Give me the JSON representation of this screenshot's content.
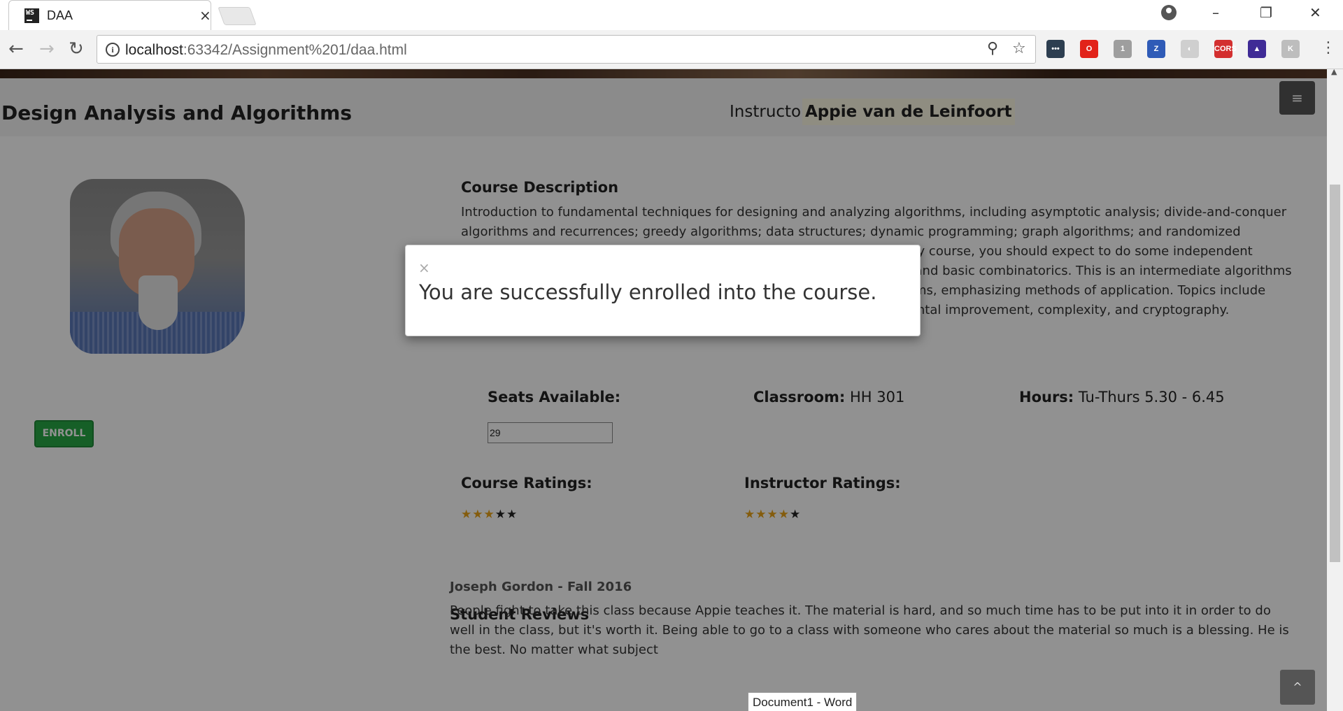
{
  "browser": {
    "tab_title": "DAA",
    "tab_close": "×",
    "favicon_text": "WS",
    "url_host": "localhost",
    "url_rest": ":63342/Assignment%201/daa.html",
    "window_controls": {
      "minimize": "–",
      "restore": "❐",
      "close": "✕"
    },
    "extensions": [
      {
        "name": "ext-dots-icon",
        "label": "•••",
        "color": "#2d3e50"
      },
      {
        "name": "ext-opera-icon",
        "label": "O",
        "color": "#e2231a"
      },
      {
        "name": "ext-shield-icon",
        "label": "1",
        "color": "#9e9e9e"
      },
      {
        "name": "ext-z-icon",
        "label": "Z",
        "color": "#2f5bb7"
      },
      {
        "name": "ext-moon-icon",
        "label": "◐",
        "color": "#cfcfcf"
      },
      {
        "name": "ext-cors-icon",
        "label": "CORS",
        "color": "#d32f2f"
      },
      {
        "name": "ext-graph-icon",
        "label": "▲",
        "color": "#3f2b96"
      },
      {
        "name": "ext-puzzle-icon",
        "label": "K",
        "color": "#bdbdbd"
      }
    ]
  },
  "page": {
    "title": "Design Analysis and Algorithms",
    "instructor_label": "Instructor:",
    "instructor_name": "Appie van de Leinfoort",
    "menu_icon": "≡",
    "enroll_label": "ENROLL",
    "course_description_heading": "Course Description",
    "course_description": "Introduction to fundamental techniques for designing and analyzing algorithms, including asymptotic analysis; divide-and-conquer algorithms and recurrences; greedy algorithms; data structures; dynamic programming; graph algorithms; and randomized algorithms. Introduction to proofs, and if you have not taken a probability course, you should expect to do some independent reading about probability, random variables, expectation, conditioning, and basic combinatorics. This is an intermediate algorithms course with an emphasis on the design and analysis of efficient algorithms, emphasizing methods of application. Topics include divide-and-conquer, dynamic programming, greedy algorithms, incremental improvement, complexity, and cryptography.",
    "seats_label": "Seats Available:",
    "seats_value": "29",
    "classroom_label": "Classroom:",
    "classroom_value": "HH 301",
    "hours_label": "Hours:",
    "hours_value": "Tu-Thurs 5.30 - 6.45",
    "course_ratings_label": "Course Ratings:",
    "course_rating": 3,
    "instructor_ratings_label": "Instructor Ratings:",
    "instructor_rating": 4,
    "rating_max": 5,
    "reviews_heading": "Student Reviews",
    "reviews": [
      {
        "author": "Joseph Gordon - Fall 2016",
        "text": "People fight to take this class because Appie teaches it. The material is hard, and so much time has to be put into it in order to do well in the class, but it's worth it. Being able to go to a class with someone who cares about the material so much is a blessing. He is the best. No matter what subject"
      }
    ],
    "back_to_top_icon": "^"
  },
  "modal": {
    "close": "×",
    "message": "You are successfully enrolled into the course."
  },
  "taskbar_tooltip": "Document1 - Word"
}
